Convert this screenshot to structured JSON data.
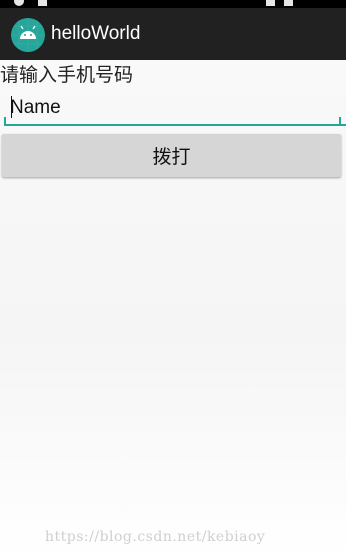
{
  "app_bar": {
    "title": "helloWorld",
    "icon": "android-icon",
    "background": "#212121",
    "icon_color": "#26a69a"
  },
  "form": {
    "prompt_label": "请输入手机号码",
    "phone_input": {
      "value": "",
      "placeholder": "Name"
    },
    "dial_button_label": "拨打",
    "accent": "#26a69a"
  },
  "watermark": "https://blog.csdn.net/kebiaoy"
}
